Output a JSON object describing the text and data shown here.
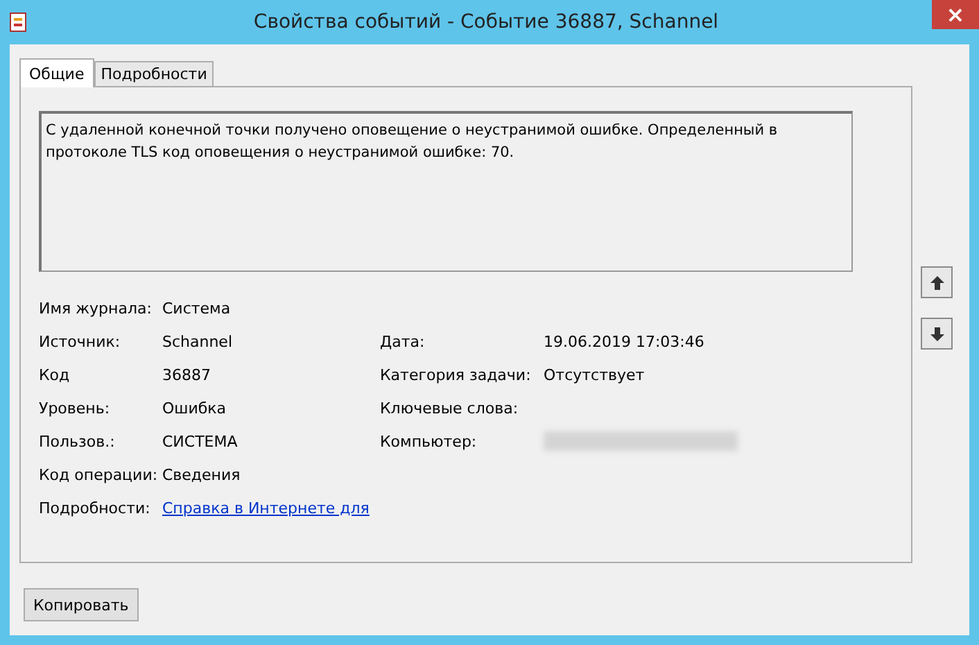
{
  "window": {
    "title": "Свойства событий - Событие 36887, Schannel",
    "close": "×"
  },
  "tabs": [
    {
      "label": "Общие",
      "selected": true
    },
    {
      "label": "Подробности",
      "selected": false
    }
  ],
  "description": "С удаленной конечной точки получено оповещение о неустранимой ошибке. Определенный в протоколе TLS код оповещения о неустранимой ошибке: 70.",
  "fields_left": [
    {
      "label": "Имя журнала:",
      "value": "Система"
    },
    {
      "label": "Источник:",
      "value": "Schannel"
    },
    {
      "label": "Код",
      "value": "36887"
    },
    {
      "label": "Уровень:",
      "value": "Ошибка"
    },
    {
      "label": "Пользов.:",
      "value": "СИСТЕМА"
    },
    {
      "label": "Код операции:",
      "value": "Сведения"
    },
    {
      "label": "Подробности:",
      "value": "Справка в Интернете для",
      "kind": "link"
    }
  ],
  "fields_right": [
    {
      "label": "Дата:",
      "value": "19.06.2019 17:03:46"
    },
    {
      "label": "Категория задачи:",
      "value": "Отсутствует"
    },
    {
      "label": "Ключевые слова:"
    },
    {
      "label": "Компьютер:",
      "kind": "redacted"
    }
  ],
  "buttons": [
    {
      "label": "Копировать"
    }
  ]
}
